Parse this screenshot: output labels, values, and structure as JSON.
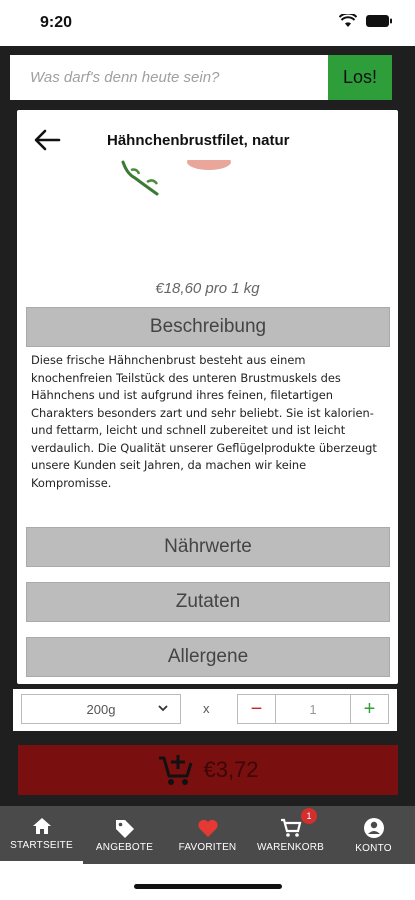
{
  "status": {
    "time": "9:20"
  },
  "search": {
    "placeholder": "Was darf's denn heute sein?",
    "button_label": "Los!"
  },
  "product": {
    "title": "Hähnchenbrustfilet, natur",
    "price": "€18,60 pro 1 kg",
    "description": "Diese frische Hähnchenbrust besteht aus einem knochenfreien Teilstück des unteren Brustmuskels des Hähnchens und ist aufgrund ihres feinen, filetartigen Charakters besonders zart und sehr beliebt. Sie ist kalorien- und fettarm, leicht und schnell zubereitet und ist leicht verdaulich. Die Qualität unserer Geflügelprodukte überzeugt unsere Kunden seit Jahren, da machen wir keine Kompromisse."
  },
  "sections": {
    "description_label": "Beschreibung",
    "nutrition_label": "Nährwerte",
    "ingredients_label": "Zutaten",
    "allergens_label": "Allergene"
  },
  "order": {
    "weight_selected": "200g",
    "times_symbol": "x",
    "minus": "−",
    "quantity": "1",
    "plus": "+",
    "total": "€3,72"
  },
  "nav": {
    "items": [
      {
        "label": "STARTSEITE",
        "icon": "home-icon"
      },
      {
        "label": "ANGEBOTE",
        "icon": "tag-icon"
      },
      {
        "label": "FAVORITEN",
        "icon": "heart-icon"
      },
      {
        "label": "WARENKORB",
        "icon": "cart-icon"
      },
      {
        "label": "KONTO",
        "icon": "account-icon"
      }
    ],
    "cart_badge": "1"
  },
  "colors": {
    "accent_green": "#2e9e3b",
    "cart_red": "#7a0f0f",
    "favorite_red": "#e53935",
    "nav_bg": "#4a4a4a"
  }
}
